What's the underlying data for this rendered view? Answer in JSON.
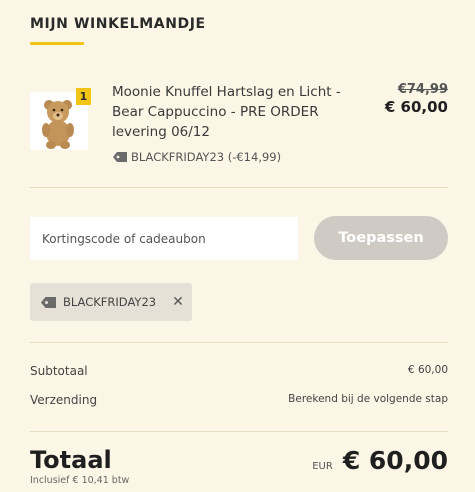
{
  "cart": {
    "title": "MIJN WINKELMANDJE"
  },
  "product": {
    "quantity": "1",
    "name": "Moonie Knuffel Hartslag en Licht - Bear Cappuccino - PRE ORDER levering 06/12",
    "discount_code_label": "BLACKFRIDAY23 (-€14,99)",
    "price_old": "€74,99",
    "price_new": "€ 60,00",
    "image_icon": "teddy-bear-icon"
  },
  "coupon": {
    "placeholder": "Kortingscode of cadeaubon",
    "apply_label": "Toepassen",
    "applied_code": "BLACKFRIDAY23"
  },
  "summary": {
    "subtotal_label": "Subtotaal",
    "subtotal_value": "€ 60,00",
    "shipping_label": "Verzending",
    "shipping_value": "Berekend bij de volgende stap",
    "total_label": "Totaal",
    "tax_note": "Inclusief € 10,41 btw",
    "currency": "EUR",
    "total_value": "€ 60,00"
  },
  "colors": {
    "background": "#fbf6e6",
    "accent": "#f2c416",
    "button_disabled": "#cfcbc4"
  }
}
